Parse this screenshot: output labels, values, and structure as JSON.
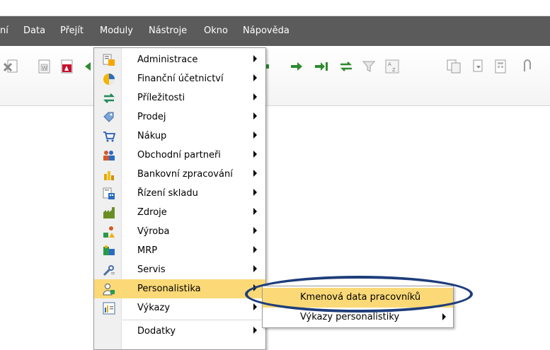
{
  "menubar": {
    "items": [
      "ní",
      "Data",
      "Přejít",
      "Moduly",
      "Nástroje",
      "Okno",
      "Nápověda"
    ]
  },
  "toolbar": {
    "icons": [
      "excel-export-icon",
      "word-export-icon",
      "pdf-export-icon",
      "arrow-first-icon",
      "arrow-next-icon",
      "arrow-last-icon",
      "refresh-icon",
      "filter-icon",
      "sort-icon",
      "copy-icon",
      "paste-icon",
      "calc-icon",
      "clip-icon"
    ]
  },
  "moduly_menu": {
    "items": [
      {
        "label": "Administrace",
        "icon": "administration-icon"
      },
      {
        "label": "Finanční účetnictví",
        "icon": "financial-accounting-icon"
      },
      {
        "label": "Příležitosti",
        "icon": "opportunities-icon"
      },
      {
        "label": "Prodej",
        "icon": "sales-icon"
      },
      {
        "label": "Nákup",
        "icon": "purchasing-icon"
      },
      {
        "label": "Obchodní partneři",
        "icon": "business-partners-icon"
      },
      {
        "label": "Bankovní zpracování",
        "icon": "banking-icon"
      },
      {
        "label": "Řízení skladu",
        "icon": "inventory-icon"
      },
      {
        "label": "Zdroje",
        "icon": "resources-icon"
      },
      {
        "label": "Výroba",
        "icon": "production-icon"
      },
      {
        "label": "MRP",
        "icon": "mrp-icon"
      },
      {
        "label": "Servis",
        "icon": "service-icon"
      },
      {
        "label": "Personalistika",
        "icon": "human-resources-icon"
      },
      {
        "label": "Výkazy",
        "icon": "reports-icon"
      },
      {
        "label": "Dodatky",
        "icon": ""
      }
    ],
    "highlighted": "Personalistika"
  },
  "personalistika_submenu": {
    "items": [
      {
        "label": "Kmenová data pracovníků"
      },
      {
        "label": "Výkazy personalistiky"
      }
    ],
    "highlighted": "Kmenová data pracovníků"
  },
  "colors": {
    "menubar_bg": "#5b5b5b",
    "highlight": "#fbd977",
    "annotation_ellipse": "#1e3d7a"
  }
}
